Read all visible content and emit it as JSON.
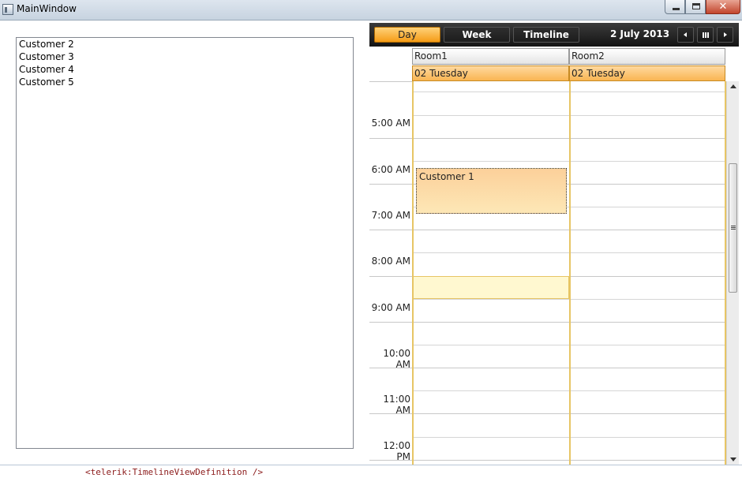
{
  "window": {
    "title": "MainWindow",
    "close_glyph": "✕"
  },
  "list": {
    "items": [
      "Customer 2",
      "Customer 3",
      "Customer 4",
      "Customer 5"
    ]
  },
  "scheduler": {
    "tabs": [
      {
        "label": "Day",
        "active": true
      },
      {
        "label": "Week",
        "active": false
      },
      {
        "label": "Timeline",
        "active": false
      }
    ],
    "current_date": "2 July 2013",
    "nav_icons": [
      "prev-arrow-icon",
      "calendar-icon",
      "next-arrow-icon"
    ],
    "rooms": [
      {
        "name": "Room1",
        "day_label": "02 Tuesday"
      },
      {
        "name": "Room2",
        "day_label": "02 Tuesday"
      }
    ],
    "hours": [
      "5:00 AM",
      "6:00 AM",
      "7:00 AM",
      "8:00 AM",
      "9:00 AM",
      "10:00 AM",
      "11:00 AM",
      "12:00 PM"
    ],
    "appointment": {
      "title": "Customer 1",
      "room": "Room1"
    },
    "colors": {
      "accent_orange": "#f59b16",
      "day_header": "#f9b552",
      "column_border": "#e7c565",
      "appointment_fill": "#fcd09a",
      "highlight_slot": "#fff8d0",
      "toolbar_bg": "#141414"
    }
  },
  "code_fragment": "<telerik:TimelineViewDefinition />"
}
